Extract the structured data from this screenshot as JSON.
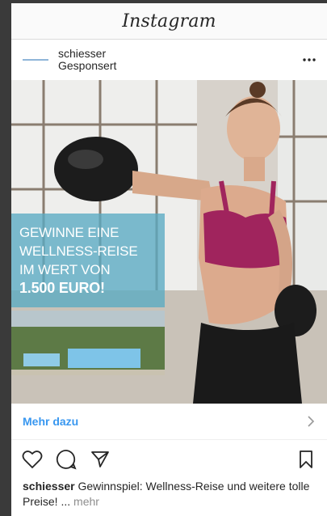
{
  "app": {
    "title": "Instagram"
  },
  "post": {
    "account": "schiesser",
    "sponsored": "Gesponsert",
    "more_icon": "more-horizontal-icon",
    "promo": {
      "line1": "GEWINNE EINE",
      "line2": "WELLNESS-REISE",
      "line3": "IM WERT VON",
      "line4": "1.500 EURO!"
    },
    "cta_label": "Mehr dazu",
    "caption_user": "schiesser",
    "caption_text": " Gewinnspiel: Wellness-Reise und weitere tolle Preise! ...",
    "caption_more": " mehr"
  },
  "icons": {
    "like": "heart-icon",
    "comment": "comment-icon",
    "share": "send-icon",
    "save": "bookmark-icon"
  },
  "colors": {
    "link": "#3897f0",
    "promo_overlay": "#5aaac3"
  }
}
